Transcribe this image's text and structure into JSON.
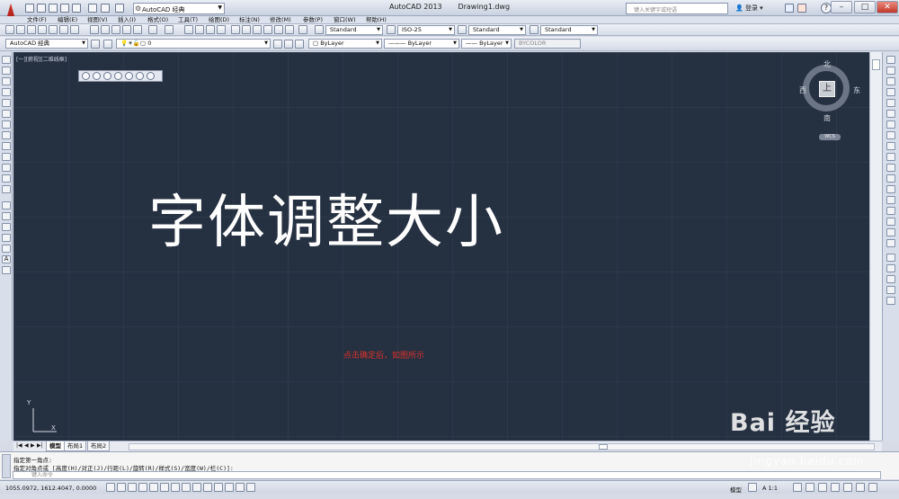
{
  "title_bar": {
    "workspace": "AutoCAD 经典",
    "app_name": "AutoCAD 2013",
    "file_name": "Drawing1.dwg",
    "search_placeholder": "键入关键字或短语",
    "login_label": "登录",
    "help_label": "?"
  },
  "menu": [
    "文件(F)",
    "编辑(E)",
    "视图(V)",
    "插入(I)",
    "格式(O)",
    "工具(T)",
    "绘图(D)",
    "标注(N)",
    "修改(M)",
    "参数(P)",
    "窗口(W)",
    "帮助(H)"
  ],
  "styles_toolbar": {
    "text_style": "Standard",
    "dim_style": "ISO-25",
    "table_style": "Standard",
    "mleader_style": "Standard"
  },
  "layers_toolbar": {
    "workspace": "AutoCAD 经典",
    "layer": "0",
    "color": "ByLayer",
    "linetype": "ByLayer",
    "lineweight": "ByLayer",
    "plot_style": "BYCOLOR"
  },
  "viewport": {
    "controls": "[一][俯视][二维线框]",
    "drawing_text": "字体调整大小",
    "caption": "点击确定后，如图所示",
    "ucs_y": "Y",
    "ucs_x": "X"
  },
  "viewcube": {
    "north": "北",
    "south": "南",
    "east": "东",
    "west": "西",
    "face": "上",
    "wcs": "WCS"
  },
  "tabs": [
    "模型",
    "布局1",
    "布局2"
  ],
  "command": {
    "history": [
      "指定第一角点:",
      "指定对角点或 [高度(H)/对正(J)/行距(L)/旋转(R)/样式(S)/宽度(W)/栏(C)]:"
    ],
    "placeholder": "键入命令"
  },
  "status": {
    "coords": "1055.0972, 1612.4047, 0.0000",
    "model": "模型",
    "scale": "A 1:1"
  },
  "watermark": {
    "brand": "Bai 经验",
    "url": "jingyan.baidu.com"
  },
  "colors": {
    "canvas_bg": "#253041",
    "caption_red": "#e0312a",
    "drawing_text": "#ffffff"
  }
}
